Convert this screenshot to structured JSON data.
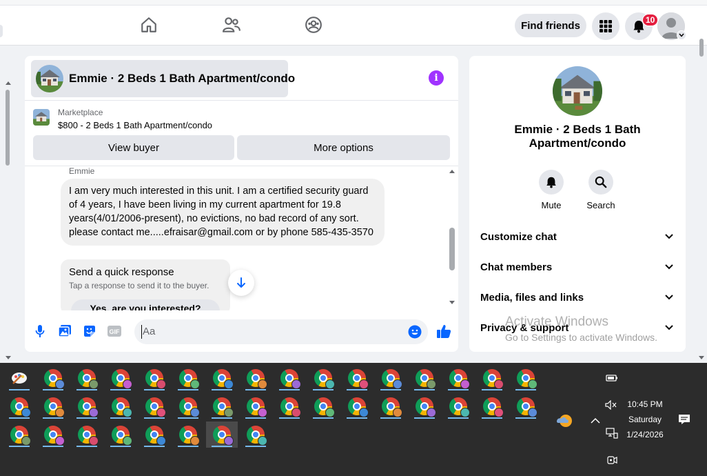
{
  "nav": {
    "find_friends": "Find friends",
    "notifications_count": "10",
    "icons": [
      "home-icon",
      "friends-icon",
      "groups-icon",
      "menu-grid-icon",
      "bell-icon"
    ]
  },
  "chat": {
    "title": "Emmie · 2 Beds 1 Bath Apartment/condo",
    "marketplace_label": "Marketplace",
    "listing": "$800 - 2 Beds 1 Bath Apartment/condo",
    "view_buyer": "View buyer",
    "more_options": "More options",
    "sender": "Emmie",
    "message": "I am very much interested in this unit. I am a certified security guard of 4 years, I have been living in my current apartment for 19.8 years(4/01/2006-present), no evictions, no bad record of any sort. please contact me.....efraisar@gmail.com or by phone 585-435-3570",
    "quick_title": "Send a quick response",
    "quick_sub": "Tap a response to send it to the buyer.",
    "quick_option": "Yes, are you interested?",
    "input_placeholder": "Aa"
  },
  "info_panel": {
    "title": "Emmie · 2 Beds 1 Bath Apartment/condo",
    "mute": "Mute",
    "search": "Search",
    "rows": [
      "Customize chat",
      "Chat members",
      "Media, files and links",
      "Privacy & support"
    ]
  },
  "watermark": {
    "line1": "Activate Windows",
    "line2": "Go to Settings to activate Windows."
  },
  "taskbar": {
    "time": "10:45 PM",
    "day": "Saturday",
    "date": "1/24/2026",
    "badge_colors": [
      "#5b8bd8",
      "#7a9a6a",
      "#c45fd0",
      "#d94c6e",
      "#5fb878",
      "#3c88d6",
      "#e08a3c",
      "#9b6ad6",
      "#4bb7b0",
      "#e0507a"
    ]
  },
  "colors": {
    "brand_blue": "#0866ff",
    "info_purple": "#a033ff",
    "badge_red": "#e41e3f"
  }
}
